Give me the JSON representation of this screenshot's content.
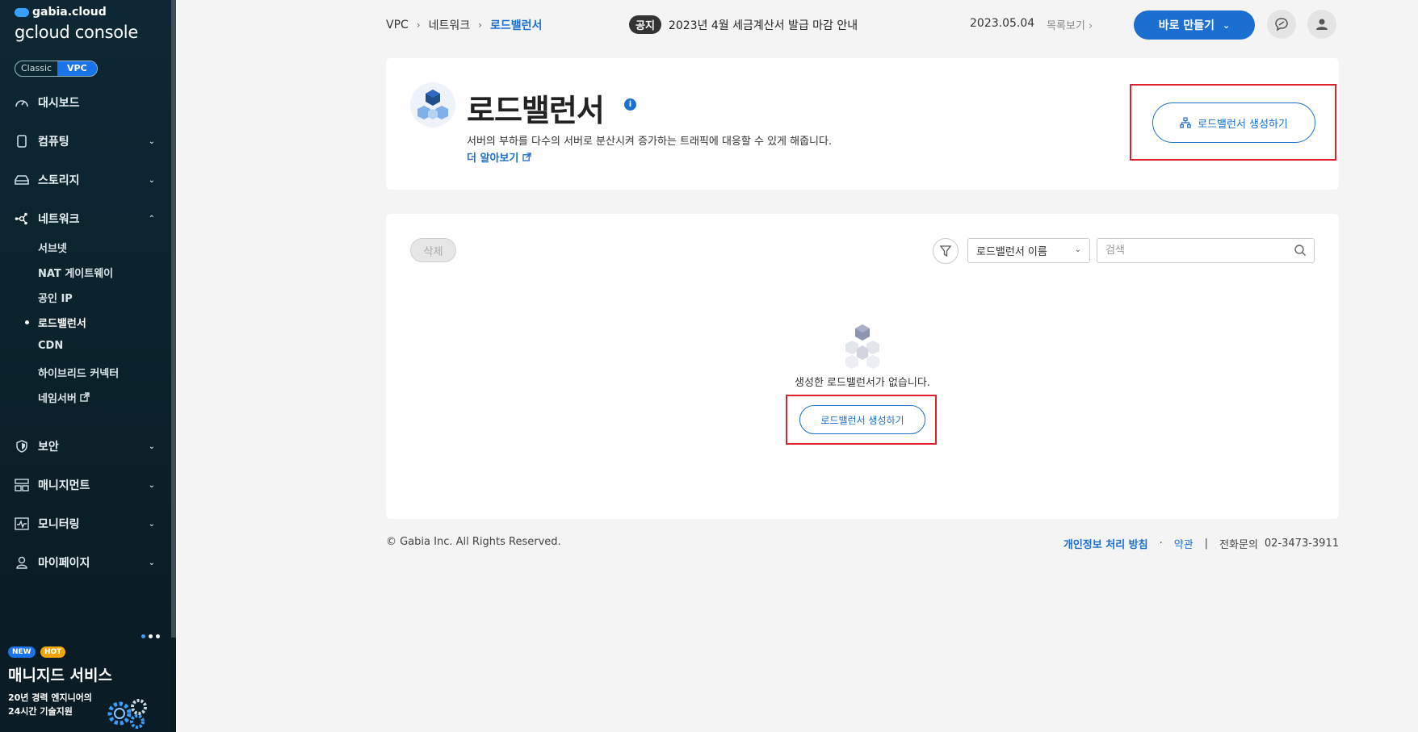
{
  "brand": {
    "small": "gabia.cloud",
    "main_bold": "gcloud",
    "main_light": "console"
  },
  "mode_toggle": {
    "classic": "Classic",
    "vpc": "VPC"
  },
  "sidebar": {
    "items": [
      {
        "label": "대시보드",
        "icon": "dashboard-icon"
      },
      {
        "label": "컴퓨팅",
        "icon": "chip-icon"
      },
      {
        "label": "스토리지",
        "icon": "storage-icon"
      },
      {
        "label": "네트워크",
        "icon": "network-icon"
      },
      {
        "label": "보안",
        "icon": "shield-icon"
      },
      {
        "label": "매니지먼트",
        "icon": "management-icon"
      },
      {
        "label": "모니터링",
        "icon": "monitor-icon"
      },
      {
        "label": "마이페이지",
        "icon": "user-icon"
      }
    ],
    "network_sub": [
      "서브넷",
      "NAT 게이트웨이",
      "공인 IP",
      "로드밸런서",
      "CDN",
      "하이브리드 커넥터",
      "네임서버"
    ]
  },
  "promo": {
    "badge_new": "NEW",
    "badge_hot": "HOT",
    "title": "매니지드 서비스",
    "desc_line1": "20년 경력 엔지니어의",
    "desc_line2": "24시간 기술지원"
  },
  "breadcrumb": {
    "level1": "VPC",
    "level2": "네트워크",
    "current": "로드밸런서"
  },
  "notice": {
    "tag": "공지",
    "text": "2023년 4월 세금계산서 발급 마감 안내",
    "date": "2023.05.04",
    "list_link": "목록보기"
  },
  "topbar": {
    "make_button": "바로 만들기"
  },
  "header": {
    "title": "로드밸런서",
    "description": "서버의 부하를 다수의 서버로 분산시켜 증가하는 트래픽에 대응할 수 있게 해줍니다.",
    "learn_more": "더 알아보기",
    "create_button": "로드밸런서 생성하기"
  },
  "list": {
    "delete_button": "삭제",
    "filter_select": "로드밸런서 이름",
    "search_placeholder": "검색",
    "empty_text": "생성한 로드밸런서가 없습니다.",
    "create_button": "로드밸런서 생성하기"
  },
  "footer": {
    "copyright": "© Gabia Inc. All Rights Reserved.",
    "privacy": "개인정보 처리 방침",
    "dot": "·",
    "terms": "약관",
    "divider": "|",
    "phone_label": "전화문의",
    "phone": "02-3473-3911"
  },
  "colors": {
    "accent": "#1a6fd0",
    "sidebar_bg": "#0c2530",
    "highlight": "#e0202a"
  }
}
